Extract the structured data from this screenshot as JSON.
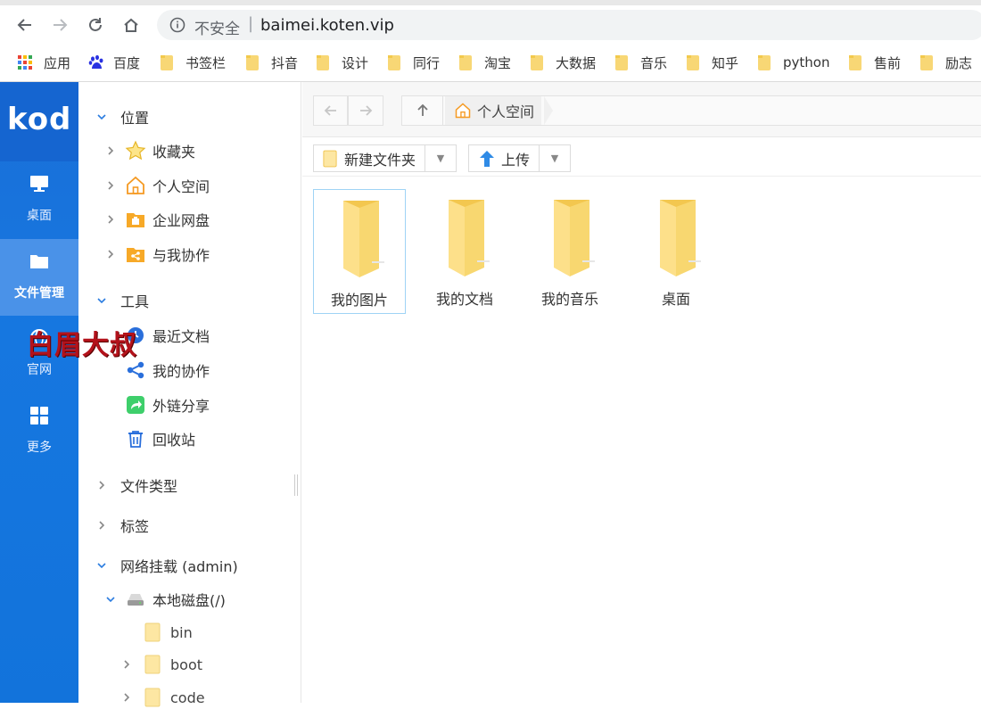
{
  "browser": {
    "insecure_label": "不安全",
    "separator": "|",
    "url": "baimei.koten.vip",
    "bookmarks": [
      {
        "label": "应用",
        "icon": "apps-icon"
      },
      {
        "label": "百度",
        "icon": "baidu-paw-icon"
      },
      {
        "label": "书签栏",
        "icon": "folder-icon"
      },
      {
        "label": "抖音",
        "icon": "folder-icon"
      },
      {
        "label": "设计",
        "icon": "folder-icon"
      },
      {
        "label": "同行",
        "icon": "folder-icon"
      },
      {
        "label": "淘宝",
        "icon": "folder-icon"
      },
      {
        "label": "大数据",
        "icon": "folder-icon"
      },
      {
        "label": "音乐",
        "icon": "folder-icon"
      },
      {
        "label": "知乎",
        "icon": "folder-icon"
      },
      {
        "label": "python",
        "icon": "folder-icon"
      },
      {
        "label": "售前",
        "icon": "folder-icon"
      },
      {
        "label": "励志",
        "icon": "folder-icon"
      }
    ]
  },
  "rail": {
    "logo": "kod",
    "items": [
      {
        "label": "桌面",
        "icon": "monitor-icon"
      },
      {
        "label": "文件管理",
        "icon": "folder-icon"
      },
      {
        "label": "官网",
        "icon": "globe-icon"
      },
      {
        "label": "更多",
        "icon": "grid-icon"
      }
    ]
  },
  "watermark": "白眉大叔",
  "tree": {
    "location_label": "位置",
    "location_items": [
      {
        "label": "收藏夹",
        "icon": "star-icon"
      },
      {
        "label": "个人空间",
        "icon": "home-icon"
      },
      {
        "label": "企业网盘",
        "icon": "enterprise-folder-icon"
      },
      {
        "label": "与我协作",
        "icon": "share-folder-icon"
      }
    ],
    "tools_label": "工具",
    "tools_items": [
      {
        "label": "最近文档",
        "icon": "recent-icon"
      },
      {
        "label": "我的协作",
        "icon": "share-nodes-icon"
      },
      {
        "label": "外链分享",
        "icon": "external-share-icon"
      },
      {
        "label": "回收站",
        "icon": "trash-icon"
      }
    ],
    "file_types_label": "文件类型",
    "tags_label": "标签",
    "network_label": "网络挂载 (admin)",
    "local_disk_label": "本地磁盘(/)",
    "disk_children": [
      "bin",
      "boot",
      "code"
    ]
  },
  "main": {
    "breadcrumb": "个人空间",
    "new_folder_label": "新建文件夹",
    "upload_label": "上传",
    "files": [
      {
        "name": "我的图片",
        "selected": true
      },
      {
        "name": "我的文档",
        "selected": false
      },
      {
        "name": "我的音乐",
        "selected": false
      },
      {
        "name": "桌面",
        "selected": false
      }
    ]
  },
  "colors": {
    "rail_blue": "#1677e0",
    "rail_active": "#4a92e8",
    "folder_yellow": "#f8d775",
    "watermark_red": "#b3121b"
  }
}
